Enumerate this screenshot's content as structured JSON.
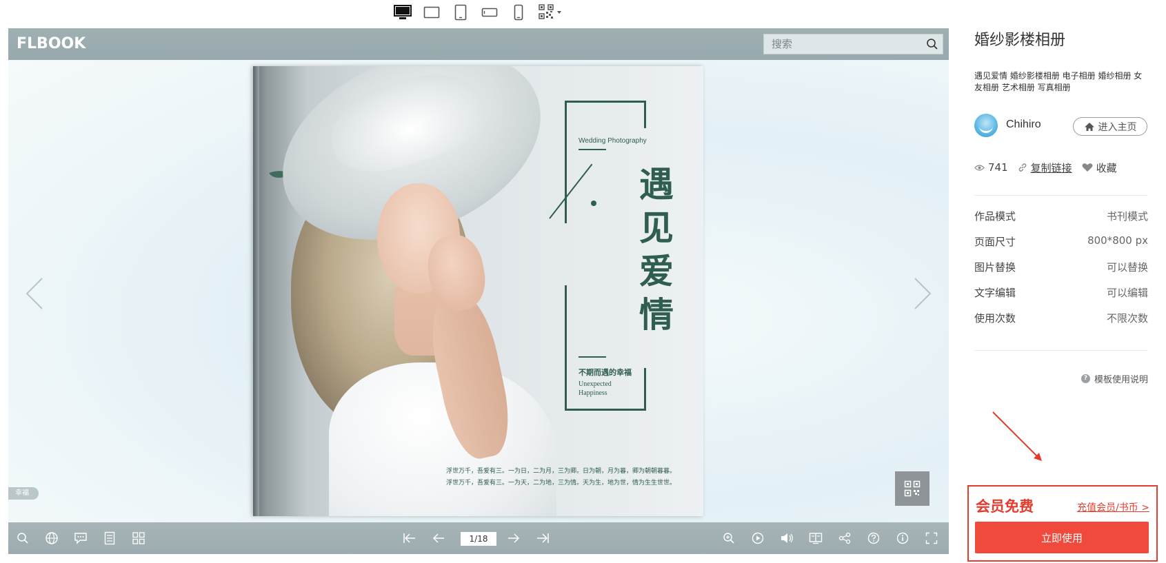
{
  "device_switcher": {
    "items": [
      {
        "icon": "desktop-icon",
        "active": true
      },
      {
        "icon": "tablet-landscape-icon",
        "active": false
      },
      {
        "icon": "tablet-portrait-icon",
        "active": false
      },
      {
        "icon": "phone-landscape-icon",
        "active": false
      },
      {
        "icon": "phone-portrait-icon",
        "active": false
      },
      {
        "icon": "qr-code-icon",
        "active": false
      }
    ]
  },
  "viewer": {
    "logo": "FLBOOK",
    "search_placeholder": "搜索",
    "side_tab": "幸福",
    "page_indicator": "1/18",
    "page": {
      "en_caption": "Wedding Photography",
      "title": "遇见爱情",
      "subtitle_cn": "不期而遇的幸福",
      "subtitle_en": "Unexpected Happiness",
      "poem_line_1": "浮世万千，吾爱有三。一为日，二为月，三为卿。日为朝，月为暮，卿为朝朝暮暮。",
      "poem_line_2": "浮世万千，吾爱有三。一为天，二为地，三为情。天为生，地为世，情为生生世世。"
    },
    "toolbar": {
      "left": [
        "search-icon",
        "globe-icon",
        "comment-icon",
        "document-icon",
        "grid-icon"
      ],
      "center": [
        "first-page-icon",
        "prev-page-icon",
        "next-page-icon",
        "last-page-icon"
      ],
      "right": [
        "zoom-in-icon",
        "play-icon",
        "sound-icon",
        "book-mode-icon",
        "share-icon",
        "help-icon",
        "info-icon",
        "fullscreen-icon"
      ]
    }
  },
  "panel": {
    "title": "婚纱影楼相册",
    "tags": "遇见爱情 婚纱影楼相册 电子相册 婚纱相册 女友相册 艺术相册 写真相册",
    "author_name": "Chihiro",
    "home_button": "进入主页",
    "views": "741",
    "copy_link": "复制链接",
    "favorite": "收藏",
    "properties": [
      {
        "key": "作品模式",
        "value": "书刊模式"
      },
      {
        "key": "页面尺寸",
        "value": "800*800 px"
      },
      {
        "key": "图片替换",
        "value": "可以替换"
      },
      {
        "key": "文字编辑",
        "value": "可以编辑"
      },
      {
        "key": "使用次数",
        "value": "不限次数"
      }
    ],
    "help_text": "模板使用说明",
    "member_free": "会员免费",
    "recharge": "充值会员/书币 >",
    "use_button": "立即使用"
  },
  "colors": {
    "accent_red": "#ef4a3b",
    "border_red": "#e53b2c",
    "toolbar_gray": "#9fb0b3",
    "page_green": "#2f5d52"
  }
}
